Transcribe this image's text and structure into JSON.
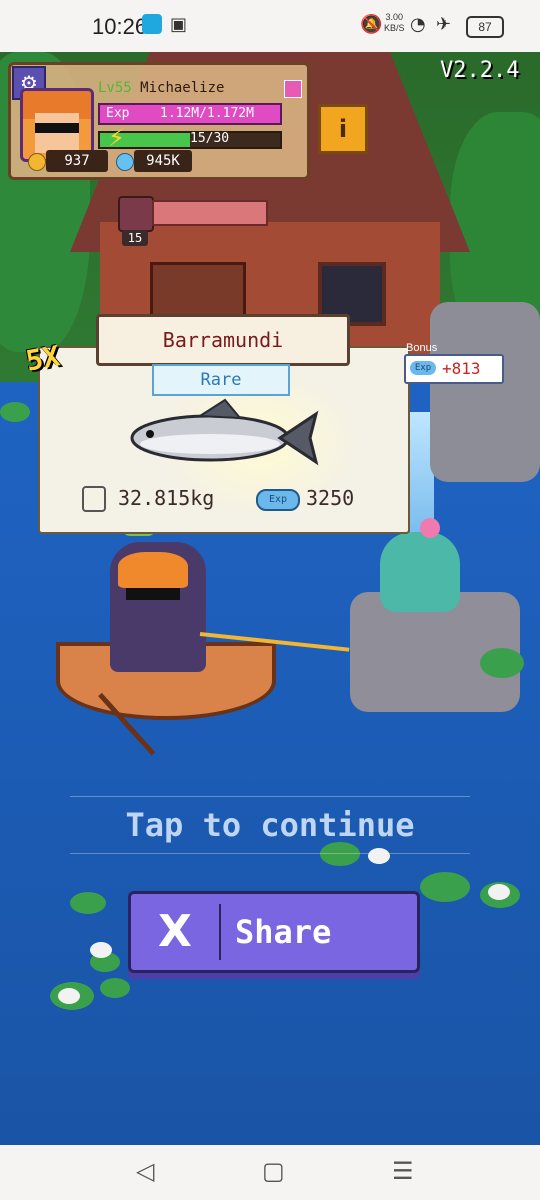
{
  "status_bar": {
    "time": "10:26",
    "net_speed": "3.00",
    "net_unit": "KB/S",
    "battery": "87",
    "icons": [
      "shield-app-icon",
      "twitch-app-icon",
      "mute-icon",
      "wifi-icon",
      "airplane-icon",
      "battery-icon"
    ]
  },
  "hud": {
    "level_prefix": "Lv55",
    "player_name": "Michaelize",
    "exp_label": "Exp",
    "exp_value": "1.12M/1.172M",
    "energy_value": "15/30",
    "energy_fraction": 0.5,
    "coins": "937",
    "gems": "945K",
    "info_label": "i"
  },
  "version": "V2.2.4",
  "bait_count": "15",
  "catch": {
    "multiplier": "5X",
    "fish_name": "Barramundi",
    "rarity": "Rare",
    "weight": "32.815kg",
    "exp_icon_label": "Exp",
    "exp": "3250",
    "bonus_label": "Bonus",
    "bonus_exp_label": "Exp",
    "bonus_value": "+813"
  },
  "tap_text": "Tap to continue",
  "share": {
    "icon_glyph": "X",
    "label": "Share"
  },
  "nav": {
    "back": "◁",
    "home": "▢",
    "menu": "☰"
  },
  "colors": {
    "water": "#1c5fb8",
    "share_button": "#7966e0",
    "exp_bar": "#e04ac2",
    "energy_bar": "#48c64b",
    "rarity_blue": "#2a7ab5",
    "bonus_red": "#c2271f"
  }
}
